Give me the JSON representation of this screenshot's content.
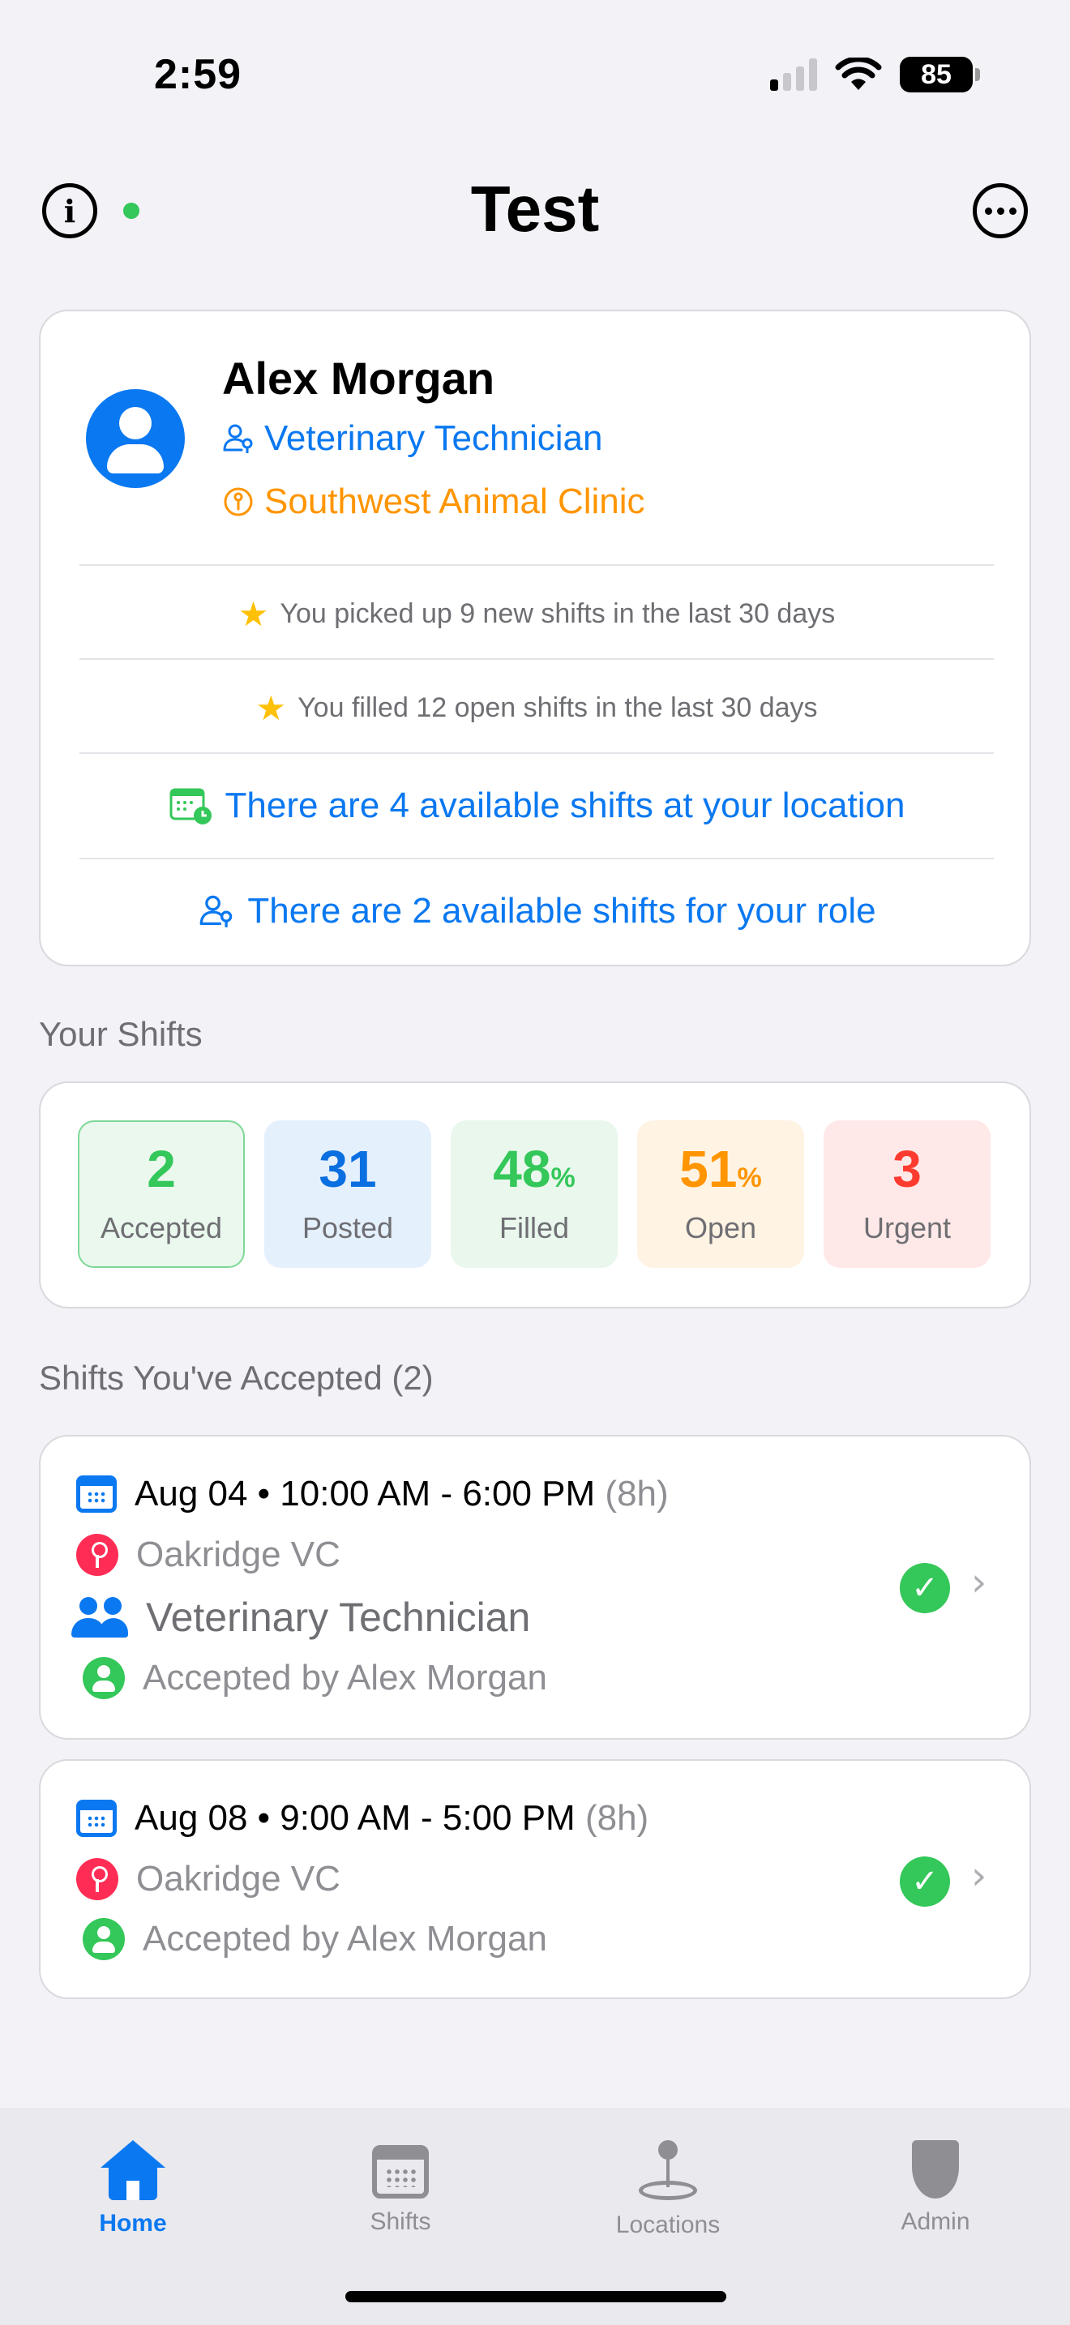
{
  "status_bar": {
    "time": "2:59",
    "battery": "85"
  },
  "nav": {
    "title": "Test"
  },
  "profile": {
    "name": "Alex Morgan",
    "role": "Veterinary Technician",
    "clinic": "Southwest Animal Clinic",
    "stats": [
      "You picked up 9 new shifts in the last 30 days",
      "You filled 12 open shifts in the last 30 days"
    ],
    "links": [
      "There are 4 available shifts at your location",
      "There are 2 available shifts for your role"
    ]
  },
  "your_shifts": {
    "title": "Your Shifts",
    "boxes": [
      {
        "value": "2",
        "unit": "",
        "label": "Accepted",
        "color": "#34c759",
        "bg": "#eaf8ee"
      },
      {
        "value": "31",
        "unit": "",
        "label": "Posted",
        "color": "#0a6fe0",
        "bg": "#e5f0fd"
      },
      {
        "value": "48",
        "unit": "%",
        "label": "Filled",
        "color": "#34c759",
        "bg": "#e9f7ed"
      },
      {
        "value": "51",
        "unit": "%",
        "label": "Open",
        "color": "#ff9500",
        "bg": "#fff3e3"
      },
      {
        "value": "3",
        "unit": "",
        "label": "Urgent",
        "color": "#ff3b30",
        "bg": "#ffe9e8"
      }
    ]
  },
  "accepted": {
    "title": "Shifts You've Accepted (2)",
    "shifts": [
      {
        "datetime": "Aug 04 • 10:00 AM - 6:00 PM",
        "duration": "(8h)",
        "location": "Oakridge VC",
        "role": "Veterinary Technician",
        "accepted_by": "Accepted by Alex Morgan"
      },
      {
        "datetime": "Aug 08 • 9:00 AM - 5:00 PM",
        "duration": "(8h)",
        "location": "Oakridge VC",
        "accepted_by": "Accepted by Alex Morgan"
      }
    ]
  },
  "tabs": [
    {
      "label": "Home",
      "icon": "house-icon"
    },
    {
      "label": "Shifts",
      "icon": "calendar-icon"
    },
    {
      "label": "Locations",
      "icon": "pin-icon"
    },
    {
      "label": "Admin",
      "icon": "shield-icon"
    }
  ],
  "colors": {
    "accent": "#0a78f0",
    "success": "#34c759",
    "warning": "#ff9500",
    "danger": "#ff3b30"
  }
}
